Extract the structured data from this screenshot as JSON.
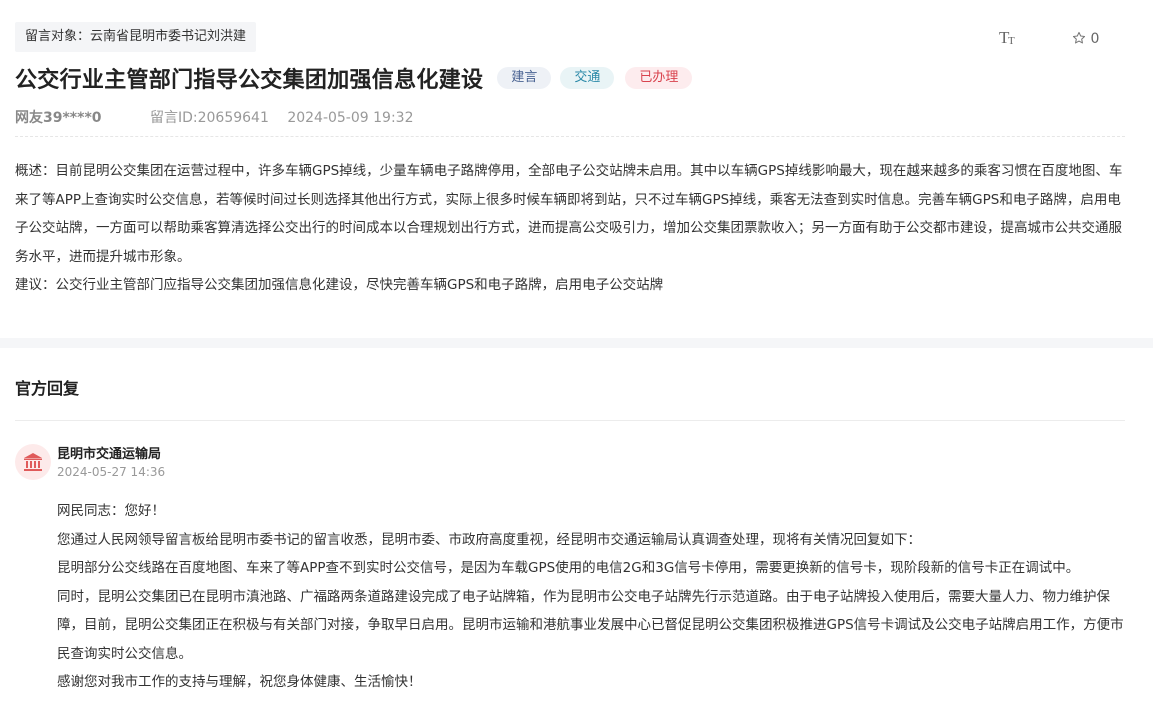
{
  "header": {
    "target_tag": "留言对象：云南省昆明市委书记刘洪建",
    "font_size_icon": "Tt",
    "favorite_count": "0"
  },
  "message": {
    "title": "公交行业主管部门指导公交集团加强信息化建设",
    "tags": [
      "建言",
      "交通",
      "已办理"
    ],
    "user": "网友39****0",
    "message_id": "留言ID:20659641",
    "date": "2024-05-09 19:32",
    "summary": "概述：目前昆明公交集团在运营过程中，许多车辆GPS掉线，少量车辆电子路牌停用，全部电子公交站牌未启用。其中以车辆GPS掉线影响最大，现在越来越多的乘客习惯在百度地图、车来了等APP上查询实时公交信息，若等候时间过长则选择其他出行方式，实际上很多时候车辆即将到站，只不过车辆GPS掉线，乘客无法查到实时信息。完善车辆GPS和电子路牌，启用电子公交站牌，一方面可以帮助乘客算清选择公交出行的时间成本以合理规划出行方式，进而提高公交吸引力，增加公交集团票款收入；另一方面有助于公交都市建设，提高城市公共交通服务水平，进而提升城市形象。",
    "suggestion": "建议：公交行业主管部门应指导公交集团加强信息化建设，尽快完善车辆GPS和电子路牌，启用电子公交站牌"
  },
  "reply": {
    "section_title": "官方回复",
    "department": "昆明市交通运输局",
    "date": "2024-05-27 14:36",
    "paragraphs": [
      "网民同志：您好！",
      "您通过人民网领导留言板给昆明市委书记的留言收悉，昆明市委、市政府高度重视，经昆明市交通运输局认真调查处理，现将有关情况回复如下：",
      "昆明部分公交线路在百度地图、车来了等APP查不到实时公交信号，是因为车载GPS使用的电信2G和3G信号卡停用，需要更换新的信号卡，现阶段新的信号卡正在调试中。",
      "同时，昆明公交集团已在昆明市滇池路、广福路两条道路建设完成了电子站牌箱，作为昆明市公交电子站牌先行示范道路。由于电子站牌投入使用后，需要大量人力、物力维护保障，目前，昆明公交集团正在积极与有关部门对接，争取早日启用。昆明市运输和港航事业发展中心已督促昆明公交集团积极推进GPS信号卡调试及公交电子站牌启用工作，方便市民查询实时公交信息。",
      "感谢您对我市工作的支持与理解，祝您身体健康、生活愉快！"
    ]
  },
  "colors": {
    "tag_suggest": "#4a6392",
    "tag_traffic": "#2a89a8",
    "tag_done": "#d9434e",
    "avatar_bg": "#fdeaea",
    "avatar_icon": "#e05a5a"
  }
}
